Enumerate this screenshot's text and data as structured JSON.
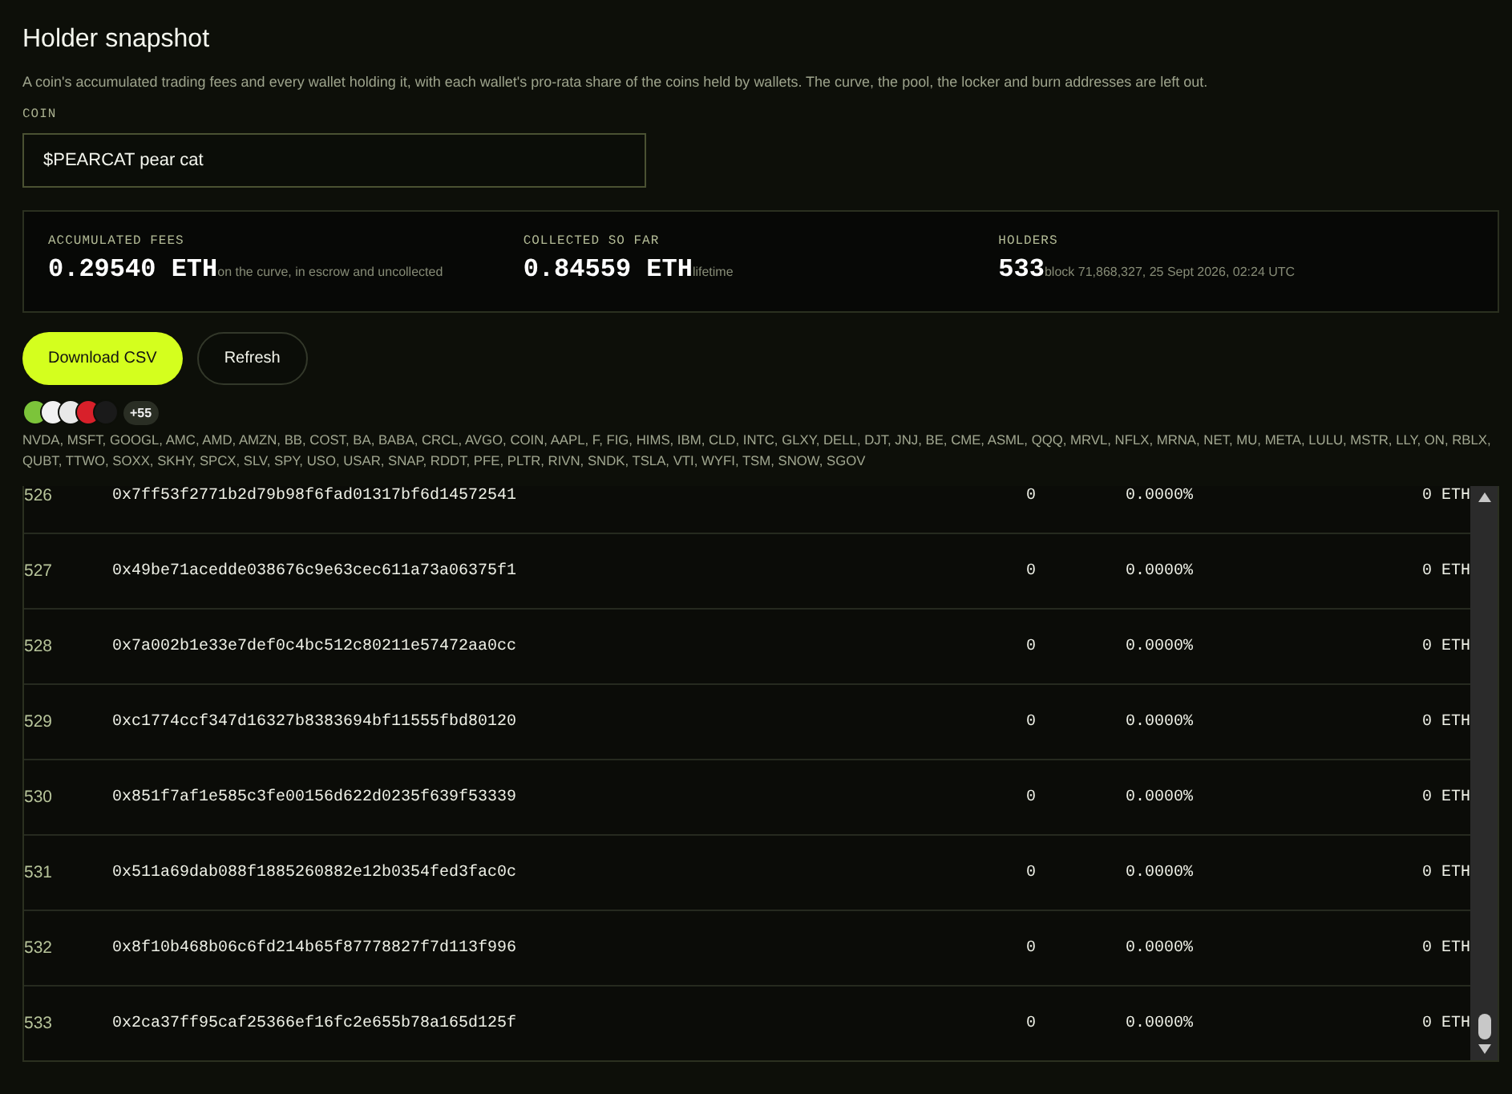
{
  "title": "Holder snapshot",
  "description": "A coin's accumulated trading fees and every wallet holding it, with each wallet's pro-rata share of the coins held by wallets. The curve, the pool, the locker and burn addresses are left out.",
  "coin": {
    "label": "COIN",
    "value": "$PEARCAT pear cat"
  },
  "stats": [
    {
      "label": "ACCUMULATED FEES",
      "value": "0.29540 ETH",
      "note": "on the curve, in escrow and uncollected"
    },
    {
      "label": "COLLECTED SO FAR",
      "value": "0.84559 ETH",
      "note": "lifetime"
    },
    {
      "label": "HOLDERS",
      "value": "533",
      "note": "block 71,868,327, 25 Sept 2026, 02:24 UTC"
    }
  ],
  "buttons": [
    {
      "label": "Download CSV",
      "kind": "primary"
    },
    {
      "label": "Refresh",
      "kind": "secondary"
    }
  ],
  "token_icons": [
    {
      "color": "#7cc43a"
    },
    {
      "color": "#f2f2f2"
    },
    {
      "color": "#e8e8e8"
    },
    {
      "color": "#d8202a"
    },
    {
      "color": "#1a1a1a"
    }
  ],
  "more_count": "+55",
  "tickers": "NVDA, MSFT, GOOGL, AMC, AMD, AMZN, BB, COST, BA, BABA, CRCL, AVGO, COIN, AAPL, F, FIG, HIMS, IBM, CLD, INTC, GLXY, DELL, DJT, JNJ, BE, CME, ASML, QQQ, MRVL, NFLX, MRNA, NET, MU, META, LULU, MSTR, LLY, ON, RBLX, QUBT, TTWO, SOXX, SKHY, SPCX, SLV, SPY, USO, USAR, SNAP, RDDT, PFE, PLTR, RIVN, SNDK, TSLA, VTI, WYFI, TSM, SNOW, SGOV",
  "rows": [
    {
      "rank": "526",
      "address": "0x7ff53f2771b2d79b98f6fad01317bf6d14572541",
      "column_3": "0",
      "share": "0.0000%",
      "fees": "0 ETH"
    },
    {
      "rank": "527",
      "address": "0x49be71acedde038676c9e63cec611a73a06375f1",
      "column_3": "0",
      "share": "0.0000%",
      "fees": "0 ETH"
    },
    {
      "rank": "528",
      "address": "0x7a002b1e33e7def0c4bc512c80211e57472aa0cc",
      "column_3": "0",
      "share": "0.0000%",
      "fees": "0 ETH"
    },
    {
      "rank": "529",
      "address": "0xc1774ccf347d16327b8383694bf11555fbd80120",
      "column_3": "0",
      "share": "0.0000%",
      "fees": "0 ETH"
    },
    {
      "rank": "530",
      "address": "0x851f7af1e585c3fe00156d622d0235f639f53339",
      "column_3": "0",
      "share": "0.0000%",
      "fees": "0 ETH"
    },
    {
      "rank": "531",
      "address": "0x511a69dab088f1885260882e12b0354fed3fac0c",
      "column_3": "0",
      "share": "0.0000%",
      "fees": "0 ETH"
    },
    {
      "rank": "532",
      "address": "0x8f10b468b06c6fd214b65f87778827f7d113f996",
      "column_3": "0",
      "share": "0.0000%",
      "fees": "0 ETH"
    },
    {
      "rank": "533",
      "address": "0x2ca37ff95caf25366ef16fc2e655b78a165d125f",
      "column_3": "0",
      "share": "0.0000%",
      "fees": "0 ETH"
    }
  ]
}
